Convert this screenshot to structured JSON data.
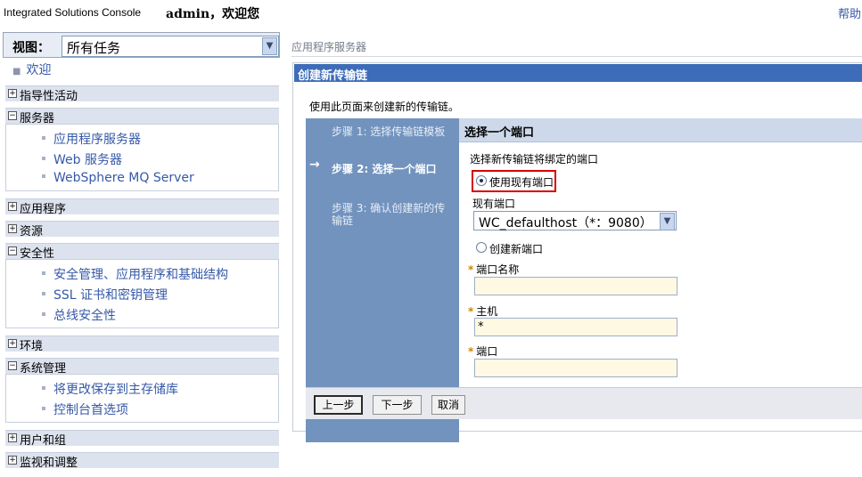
{
  "banner": {
    "product": "Integrated Solutions Console",
    "welcome": "admin，欢迎您",
    "help": "帮助"
  },
  "nav": {
    "view_label": "视图：",
    "view_value": "所有任务",
    "welcome": "欢迎",
    "categories": {
      "guided": "指导性活动",
      "servers": "服务器",
      "applications": "应用程序",
      "resources": "资源",
      "security": "安全性",
      "environment": "环境",
      "system_admin": "系统管理",
      "users_groups": "用户和组",
      "monitoring": "监视和调整"
    },
    "toggle_expanded": "−",
    "toggle_collapsed": "+",
    "servers_items": [
      "应用程序服务器",
      "Web 服务器",
      "WebSphere MQ Server"
    ],
    "security_items": [
      "安全管理、应用程序和基础结构",
      "SSL 证书和密钥管理",
      "总线安全性"
    ],
    "sysadmin_items": [
      "将更改保存到主存储库",
      "控制台首选项"
    ]
  },
  "content": {
    "breadcrumb": "应用程序服务器",
    "wizard_title": "创建新传输链",
    "wizard_desc": "使用此页面来创建新的传输链。",
    "steps": [
      {
        "text": "步骤 1: 选择传输链模板",
        "active": false
      },
      {
        "text": "步骤 2: 选择一个端口",
        "active": true
      },
      {
        "text": "步骤 3: 确认创建新的传输链",
        "active": false
      }
    ],
    "step_arrow": "→",
    "panel_title": "选择一个端口",
    "panel_desc": "选择新传输链将绑定的端口",
    "radio_existing": "使用现有端口",
    "existing_port_label": "现有端口",
    "existing_port_value": "WC_defaulthost（*：9080）",
    "radio_new": "创建新端口",
    "required_mark": "*",
    "port_name_label": "端口名称",
    "port_name_value": "",
    "host_label": "主机",
    "host_value": "*",
    "port_label": "端口",
    "port_value": "",
    "btn_prev": "上一步",
    "btn_next": "下一步",
    "btn_cancel": "取消"
  },
  "colors": {
    "link": "#3559a8",
    "title_bar": "#3d6cb8",
    "steps_bg": "#7193be",
    "input_bg": "#fff9e3",
    "highlight": "#d80000"
  }
}
